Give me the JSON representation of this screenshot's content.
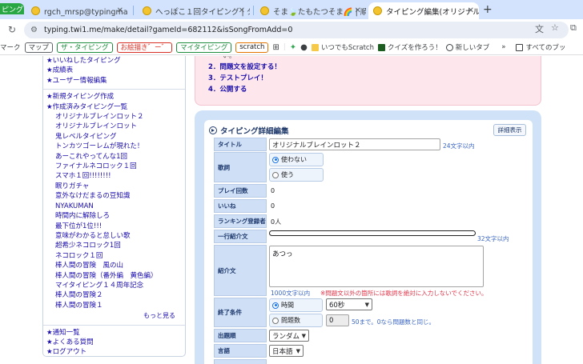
{
  "tabs": [
    {
      "title": "ピング"
    },
    {
      "title": "rgch_mrsp@typingmastar | タ"
    },
    {
      "title": "へっぽこ１回タイピング | タ"
    },
    {
      "title": "そま🍃たもたつそま🌈 | 順"
    },
    {
      "title": "タイピング編集(オリジナルブ",
      "active": true
    }
  ],
  "address": {
    "url": "typing.twi1.me/make/detail?gameId=682112&isSongFromAdd=0"
  },
  "bookmarks": [
    {
      "label": "マーク"
    },
    {
      "label": "マップ",
      "color": "#5f6368"
    },
    {
      "label": "ザ・タイピング",
      "color": "#1e8e3e"
    },
    {
      "label": "お絵描き゛ー゛",
      "color": "#d93025"
    },
    {
      "label": "マイタイピング",
      "color": "#1e8e3e"
    },
    {
      "label": "scratch",
      "color": "#e37400"
    },
    {
      "label": "いつでもScratch"
    },
    {
      "label": "クイズを作ろう！"
    },
    {
      "label": "新しいタブ"
    },
    {
      "label": "すべてのブッ"
    }
  ],
  "sidebar": {
    "group1": [
      "いいねしたタイピング",
      "成績表",
      "ユーザー情報編集"
    ],
    "group2_head": [
      "新規タイピング作成",
      "作成済みタイピング一覧"
    ],
    "created": [
      "オリジナルブレインロット２",
      "オリジナルブレインロット",
      "鬼レベルタイピング",
      "トンカツゴーレムが現れた！",
      "あーこれやってんな1回",
      "ファイナルネコロック１回",
      "スマホ１回!!!!!!!!",
      "眠りガチャ",
      "意外なけだまるの豆知識",
      "NYAKUMAN",
      "時間内に解除しろ",
      "最下位が1位!!!",
      "意味がわかると怠しい歌",
      "超希少ネコロック1回",
      "ネコロック１回",
      "棒人間の冒険　風の山",
      "棒人間の冒険（番外編　黄色編）",
      "マイタイピング１４周年記念",
      "棒人間の冒険２",
      "棒人間の冒険１"
    ],
    "more": "もっと見る",
    "group3": [
      "通知一覧",
      "よくある質問",
      "ログアウト"
    ]
  },
  "steps": {
    "fragment": "い。",
    "items": [
      "2．問題文を設定する！",
      "3．テストプレイ！",
      "4．公開する"
    ]
  },
  "detail": {
    "heading": "タイピング詳細編集",
    "detail_button": "詳細表示",
    "title_label": "タイトル",
    "title_value": "オリジナルブレインロット２",
    "title_count": "24文字以内",
    "lyrics_label": "歌詞",
    "lyrics_options": [
      "使わない",
      "使う"
    ],
    "play_count_label": "プレイ回数",
    "play_count": "0",
    "likes_label": "いいね",
    "likes": "0",
    "ranking_label": "ランキング登録者",
    "ranking": "0人",
    "oneline_label": "一行紹介文",
    "oneline_count": "32文字以内",
    "intro_label": "紹介文",
    "intro_value": "あつっ",
    "intro_count": "1000文字以内",
    "intro_warning": "※問題文以外の箇所には歌詞を絶対に入力しないでください。",
    "end_label": "終了条件",
    "end_time": "時間",
    "end_time_value": "60秒",
    "end_count": "問題数",
    "end_count_value": "0",
    "end_count_note": "50まで。0なら問題数と同じ。",
    "order_label": "出題順",
    "order_value": "ランダム",
    "lang_label": "言語",
    "lang_value": "日本語"
  }
}
